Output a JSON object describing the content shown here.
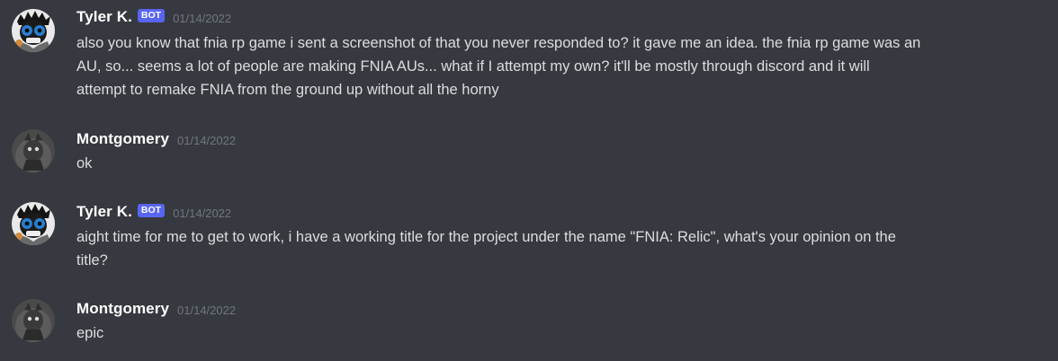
{
  "colors": {
    "background": "#36393f",
    "username": "#ffffff",
    "message_text": "#dcddde",
    "timestamp": "#72767d",
    "bot_tag": "#5865f2"
  },
  "messages": [
    {
      "author": "Tyler K.",
      "bot_tag": "BOT",
      "timestamp": "01/14/2022",
      "avatar_icon": "masked-character-avatar",
      "text": "also you know that fnia rp game i sent a screenshot of that you never responded to? it gave me an idea. the fnia rp game was an\nAU, so... seems a lot of people are making FNIA AUs... what if I attempt my own? it'll be mostly through discord and it will\nattempt to remake FNIA from the ground up without all the horny"
    },
    {
      "author": "Montgomery",
      "timestamp": "01/14/2022",
      "avatar_icon": "gray-figure-avatar",
      "text": "ok"
    },
    {
      "author": "Tyler K.",
      "bot_tag": "BOT",
      "timestamp": "01/14/2022",
      "avatar_icon": "masked-character-avatar",
      "text": "aight time for me to get to work, i have a working title for the project under the name \"FNIA: Relic\", what's your opinion on the\ntitle?"
    },
    {
      "author": "Montgomery",
      "timestamp": "01/14/2022",
      "avatar_icon": "gray-figure-avatar",
      "text": "epic"
    }
  ]
}
